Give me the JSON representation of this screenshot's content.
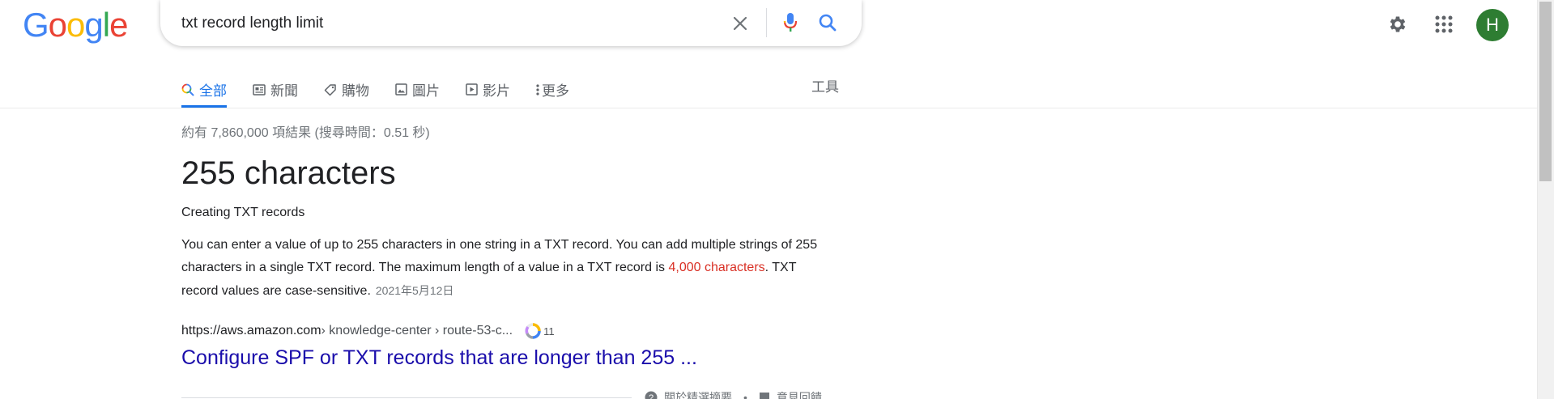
{
  "logo": {
    "letters": [
      "G",
      "o",
      "o",
      "g",
      "l",
      "e"
    ]
  },
  "search": {
    "query": "txt record length limit"
  },
  "header": {
    "avatar_initial": "H"
  },
  "tabs": [
    {
      "label": "全部",
      "icon": "search-icon",
      "active": true
    },
    {
      "label": "新聞",
      "icon": "news-icon",
      "active": false
    },
    {
      "label": "購物",
      "icon": "tag-icon",
      "active": false
    },
    {
      "label": "圖片",
      "icon": "image-icon",
      "active": false
    },
    {
      "label": "影片",
      "icon": "video-icon",
      "active": false
    },
    {
      "label": "更多",
      "icon": "more-vert-icon",
      "active": false
    }
  ],
  "tools_label": "工具",
  "stats": "約有 7,860,000 項結果 (搜尋時間：0.51 秒)",
  "featured": {
    "answer": "255 characters",
    "source_heading": "Creating TXT records",
    "snippet_before": "You can enter a value of up to 255 characters in one string in a TXT record. You can add multiple strings of 255 characters in a single TXT record. The maximum length of a value in a TXT record is ",
    "snippet_highlight": "4,000 characters",
    "snippet_after": ". TXT record values are case-sensitive.",
    "date": "2021年5月12日"
  },
  "result": {
    "domain": "https://aws.amazon.com",
    "breadcrumb": " › knowledge-center › route-53-c...",
    "count": "11",
    "title": "Configure SPF or TXT records that are longer than 255 ..."
  },
  "about": {
    "about_label": "關於精選摘要",
    "feedback_label": "意見回饋"
  },
  "colors": {
    "link": "#1a0dab",
    "accent": "#1a73e8",
    "highlight": "#d93025",
    "avatar": "#2e7d32"
  }
}
